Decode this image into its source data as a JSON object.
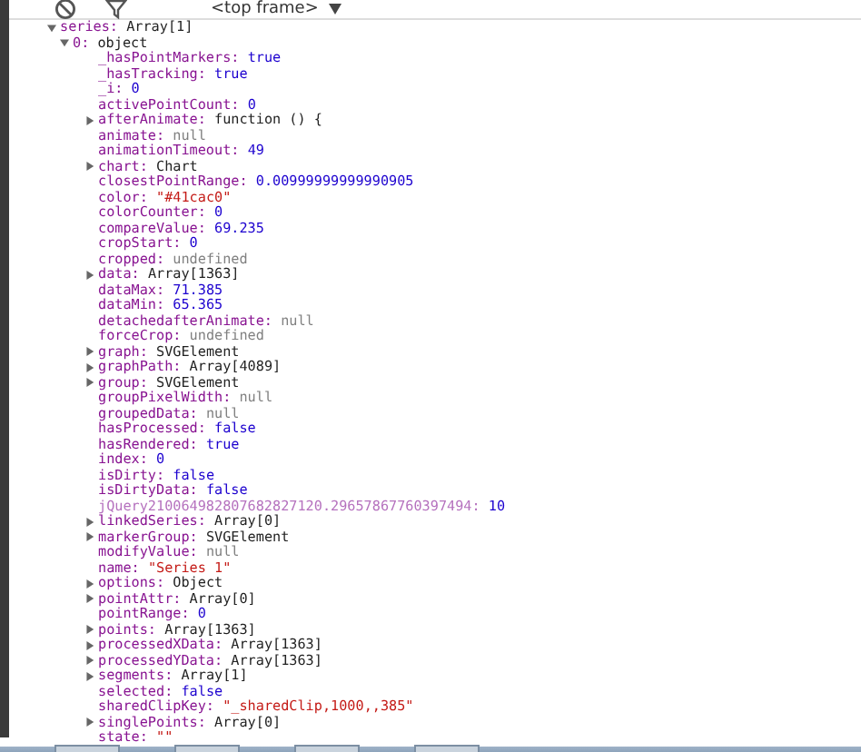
{
  "toolbar": {
    "frame_selector": "<top frame>"
  },
  "tree": [
    {
      "name": "series:",
      "value": "Array[1]",
      "kind": "object",
      "dimmed": false,
      "expanded": true,
      "children": [
        {
          "name": "0:",
          "value": "object",
          "kind": "object",
          "dimmed": false,
          "expanded": true,
          "children": [
            {
              "name": "_hasPointMarkers:",
              "value": "true",
              "kind": "boolean",
              "dimmed": false
            },
            {
              "name": "_hasTracking:",
              "value": "true",
              "kind": "boolean",
              "dimmed": false
            },
            {
              "name": "_i:",
              "value": "0",
              "kind": "number",
              "dimmed": false
            },
            {
              "name": "activePointCount:",
              "value": "0",
              "kind": "number",
              "dimmed": false
            },
            {
              "name": "afterAnimate:",
              "value": "function () {",
              "kind": "object",
              "dimmed": false,
              "expanded": false
            },
            {
              "name": "animate:",
              "value": "null",
              "kind": "null",
              "dimmed": false
            },
            {
              "name": "animationTimeout:",
              "value": "49",
              "kind": "number",
              "dimmed": false
            },
            {
              "name": "chart:",
              "value": "Chart",
              "kind": "object",
              "dimmed": false,
              "expanded": false
            },
            {
              "name": "closestPointRange:",
              "value": "0.00999999999990905",
              "kind": "number",
              "dimmed": false
            },
            {
              "name": "color:",
              "value": "\"#41cac0\"",
              "kind": "string",
              "dimmed": false
            },
            {
              "name": "colorCounter:",
              "value": "0",
              "kind": "number",
              "dimmed": false
            },
            {
              "name": "compareValue:",
              "value": "69.235",
              "kind": "number",
              "dimmed": false
            },
            {
              "name": "cropStart:",
              "value": "0",
              "kind": "number",
              "dimmed": false
            },
            {
              "name": "cropped:",
              "value": "undefined",
              "kind": "null",
              "dimmed": false
            },
            {
              "name": "data:",
              "value": "Array[1363]",
              "kind": "object",
              "dimmed": false,
              "expanded": false
            },
            {
              "name": "dataMax:",
              "value": "71.385",
              "kind": "number",
              "dimmed": false
            },
            {
              "name": "dataMin:",
              "value": "65.365",
              "kind": "number",
              "dimmed": false
            },
            {
              "name": "detachedafterAnimate:",
              "value": "null",
              "kind": "null",
              "dimmed": false
            },
            {
              "name": "forceCrop:",
              "value": "undefined",
              "kind": "null",
              "dimmed": false
            },
            {
              "name": "graph:",
              "value": "SVGElement",
              "kind": "object",
              "dimmed": false,
              "expanded": false
            },
            {
              "name": "graphPath:",
              "value": "Array[4089]",
              "kind": "object",
              "dimmed": false,
              "expanded": false
            },
            {
              "name": "group:",
              "value": "SVGElement",
              "kind": "object",
              "dimmed": false,
              "expanded": false
            },
            {
              "name": "groupPixelWidth:",
              "value": "null",
              "kind": "null",
              "dimmed": false
            },
            {
              "name": "groupedData:",
              "value": "null",
              "kind": "null",
              "dimmed": false
            },
            {
              "name": "hasProcessed:",
              "value": "false",
              "kind": "boolean",
              "dimmed": false
            },
            {
              "name": "hasRendered:",
              "value": "true",
              "kind": "boolean",
              "dimmed": false
            },
            {
              "name": "index:",
              "value": "0",
              "kind": "number",
              "dimmed": false
            },
            {
              "name": "isDirty:",
              "value": "false",
              "kind": "boolean",
              "dimmed": false
            },
            {
              "name": "isDirtyData:",
              "value": "false",
              "kind": "boolean",
              "dimmed": false
            },
            {
              "name": "jQuery210064982807682827120.29657867760397494:",
              "value": "10",
              "kind": "number",
              "dimmed": true
            },
            {
              "name": "linkedSeries:",
              "value": "Array[0]",
              "kind": "object",
              "dimmed": false,
              "expanded": false
            },
            {
              "name": "markerGroup:",
              "value": "SVGElement",
              "kind": "object",
              "dimmed": false,
              "expanded": false
            },
            {
              "name": "modifyValue:",
              "value": "null",
              "kind": "null",
              "dimmed": false
            },
            {
              "name": "name:",
              "value": "\"Series 1\"",
              "kind": "string",
              "dimmed": false
            },
            {
              "name": "options:",
              "value": "Object",
              "kind": "object",
              "dimmed": false,
              "expanded": false
            },
            {
              "name": "pointAttr:",
              "value": "Array[0]",
              "kind": "object",
              "dimmed": false,
              "expanded": false
            },
            {
              "name": "pointRange:",
              "value": "0",
              "kind": "number",
              "dimmed": false
            },
            {
              "name": "points:",
              "value": "Array[1363]",
              "kind": "object",
              "dimmed": false,
              "expanded": false
            },
            {
              "name": "processedXData:",
              "value": "Array[1363]",
              "kind": "object",
              "dimmed": false,
              "expanded": false
            },
            {
              "name": "processedYData:",
              "value": "Array[1363]",
              "kind": "object",
              "dimmed": false,
              "expanded": false
            },
            {
              "name": "segments:",
              "value": "Array[1]",
              "kind": "object",
              "dimmed": false,
              "expanded": false
            },
            {
              "name": "selected:",
              "value": "false",
              "kind": "boolean",
              "dimmed": false
            },
            {
              "name": "sharedClipKey:",
              "value": "\"_sharedClip,1000,,385\"",
              "kind": "string",
              "dimmed": false
            },
            {
              "name": "singlePoints:",
              "value": "Array[0]",
              "kind": "object",
              "dimmed": false,
              "expanded": false
            },
            {
              "name": "state:",
              "value": "\"\"",
              "kind": "string",
              "dimmed": false
            }
          ]
        }
      ]
    }
  ]
}
